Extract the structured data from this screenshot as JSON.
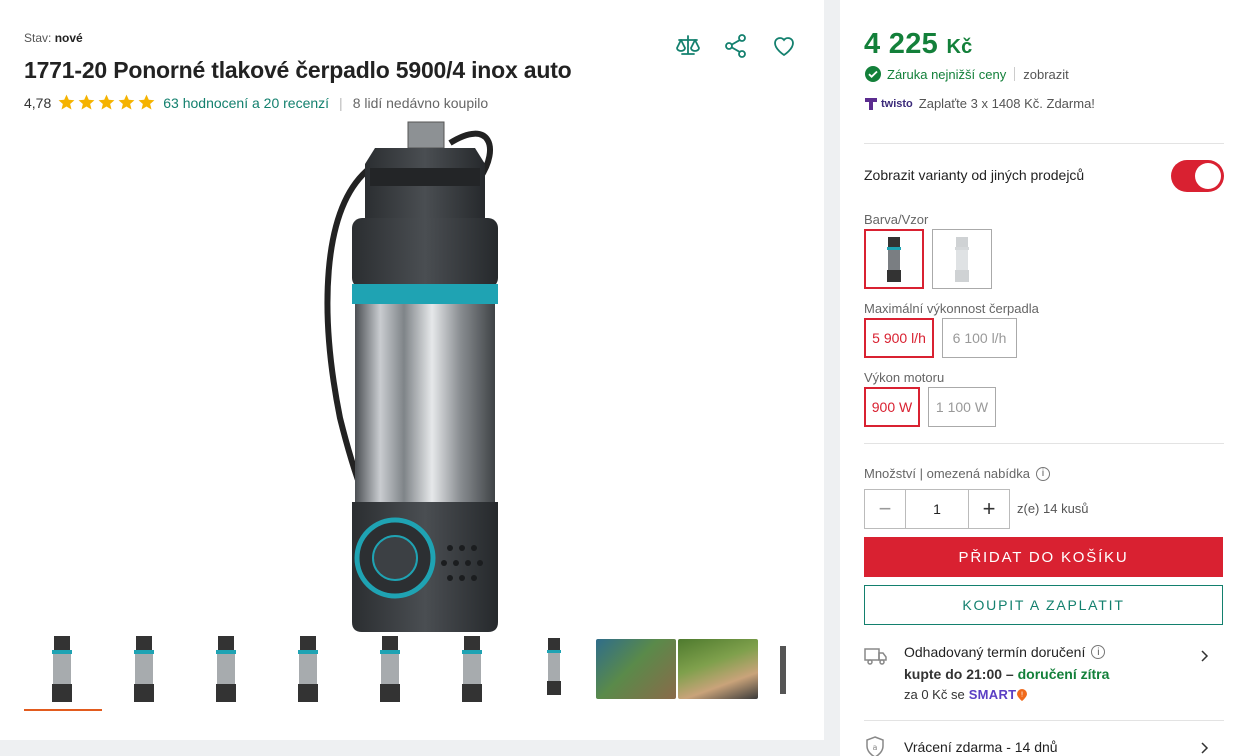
{
  "product": {
    "condition_label": "Stav:",
    "condition_value": "nové",
    "title": "1771-20 Ponorné tlakové čerpadlo 5900/4 inox auto",
    "rating": "4,78",
    "stars": 5,
    "reviews_link": "63 hodnocení a 20 recenzí",
    "recent_buyers": "8 lidí nedávno koupilo"
  },
  "actions": {
    "compare_icon": "scales-icon",
    "share_icon": "share-icon",
    "wishlist_icon": "heart-icon"
  },
  "gallery": {
    "thumbnail_count": 10,
    "active_index": 0
  },
  "pricing": {
    "price": "4 225",
    "currency": "Kč",
    "guarantee": "Záruka nejnižší ceny",
    "guarantee_link": "zobrazit",
    "twisto_brand": "twisto",
    "twisto_text": "Zaplaťte 3 x 1408 Kč. Zdarma!"
  },
  "sellers": {
    "toggle_label": "Zobrazit varianty od jiných prodejců",
    "toggle_on": true
  },
  "options": {
    "color_label": "Barva/Vzor",
    "capacity_label": "Maximální výkonnost čerpadla",
    "capacity_values": [
      "5 900 l/h",
      "6 100 l/h"
    ],
    "power_label": "Výkon motoru",
    "power_values": [
      "900 W",
      "1 100 W"
    ]
  },
  "quantity": {
    "label": "Množství | omezená nabídka",
    "value": "1",
    "note": "z(e) 14 kusů",
    "minus": "−",
    "plus": "+"
  },
  "buttons": {
    "add_to_cart": "PŘIDAT DO KOŠÍKU",
    "buy_now": "KOUPIT A ZAPLATIT"
  },
  "delivery": {
    "title": "Odhadovaný termín doručení",
    "order_by": "kupte do 21:00 –",
    "when": "doručení zítra",
    "cost_text": "za 0 Kč se",
    "program": "SMART"
  },
  "returns": {
    "text": "Vrácení zdarma - 14 dnů"
  },
  "colors": {
    "accent_red": "#d92131",
    "accent_green": "#13803a",
    "link_teal": "#13806e",
    "star": "#f5b301"
  }
}
